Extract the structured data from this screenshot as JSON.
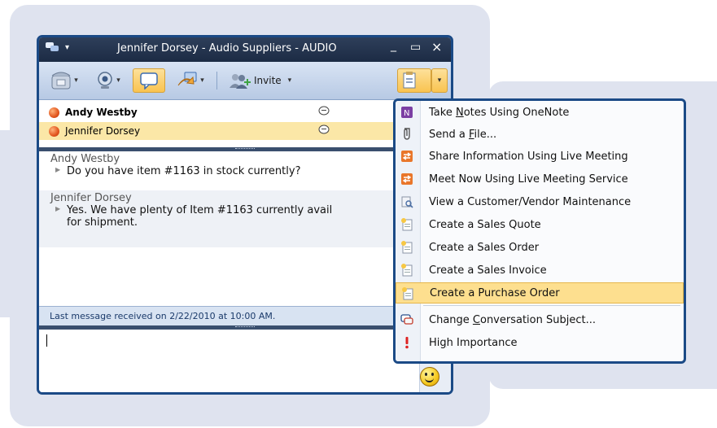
{
  "window": {
    "title": "Jennifer Dorsey - Audio Suppliers - AUDIO",
    "controls": {
      "minimize": "_",
      "maximize": "▭",
      "close": "×"
    }
  },
  "toolbar": {
    "invite_label": "Invite",
    "icons": [
      "phone-icon",
      "webcam-icon",
      "im-icon",
      "share-icon",
      "invite-people-icon",
      "action-menu-icon"
    ]
  },
  "roster": [
    {
      "name": "Andy Westby",
      "bold": true,
      "selected": false
    },
    {
      "name": "Jennifer Dorsey",
      "bold": false,
      "selected": true
    }
  ],
  "messages": [
    {
      "sender": "Andy Westby",
      "lines": [
        "Do you have item #1163 in stock currently?"
      ]
    },
    {
      "sender": "Jennifer Dorsey",
      "lines": [
        "Yes. We have plenty of Item #1163 currently avail",
        "for shipment."
      ]
    }
  ],
  "status": {
    "text": "Last message received on 2/22/2010 at 10:00 AM."
  },
  "menu": {
    "items": [
      {
        "pre": "Take ",
        "key": "N",
        "post": "otes Using OneNote",
        "icon": "onenote-icon"
      },
      {
        "pre": "Send a ",
        "key": "F",
        "post": "ile...",
        "icon": "send-file-icon"
      },
      {
        "pre": "Share Information Using Live Meeting",
        "key": "",
        "post": "",
        "icon": "live-meeting-icon"
      },
      {
        "pre": "Meet Now Using Live Meeting Service",
        "key": "",
        "post": "",
        "icon": "live-meeting-icon"
      },
      {
        "pre": "View a Customer/Vendor Maintenance",
        "key": "",
        "post": "",
        "icon": "view-record-icon"
      },
      {
        "pre": "Create a Sales Quote",
        "key": "",
        "post": "",
        "icon": "new-document-icon"
      },
      {
        "pre": "Create a Sales Order",
        "key": "",
        "post": "",
        "icon": "new-document-icon"
      },
      {
        "pre": "Create a Sales Invoice",
        "key": "",
        "post": "",
        "icon": "new-document-icon"
      },
      {
        "pre": "Create a Purchase Order",
        "key": "",
        "post": "",
        "icon": "new-document-icon",
        "highlighted": true
      },
      {
        "pre": "Change ",
        "key": "C",
        "post": "onversation Subject...",
        "icon": "conversation-subject-icon"
      },
      {
        "pre": "Hi",
        "key": "g",
        "post": "h Importance",
        "icon": "high-importance-icon"
      }
    ]
  },
  "colors": {
    "accent_border": "#1b4a86",
    "highlight": "#fddf8f",
    "presence_busy": "#e2561e",
    "background_panel": "#dfe3ef"
  }
}
